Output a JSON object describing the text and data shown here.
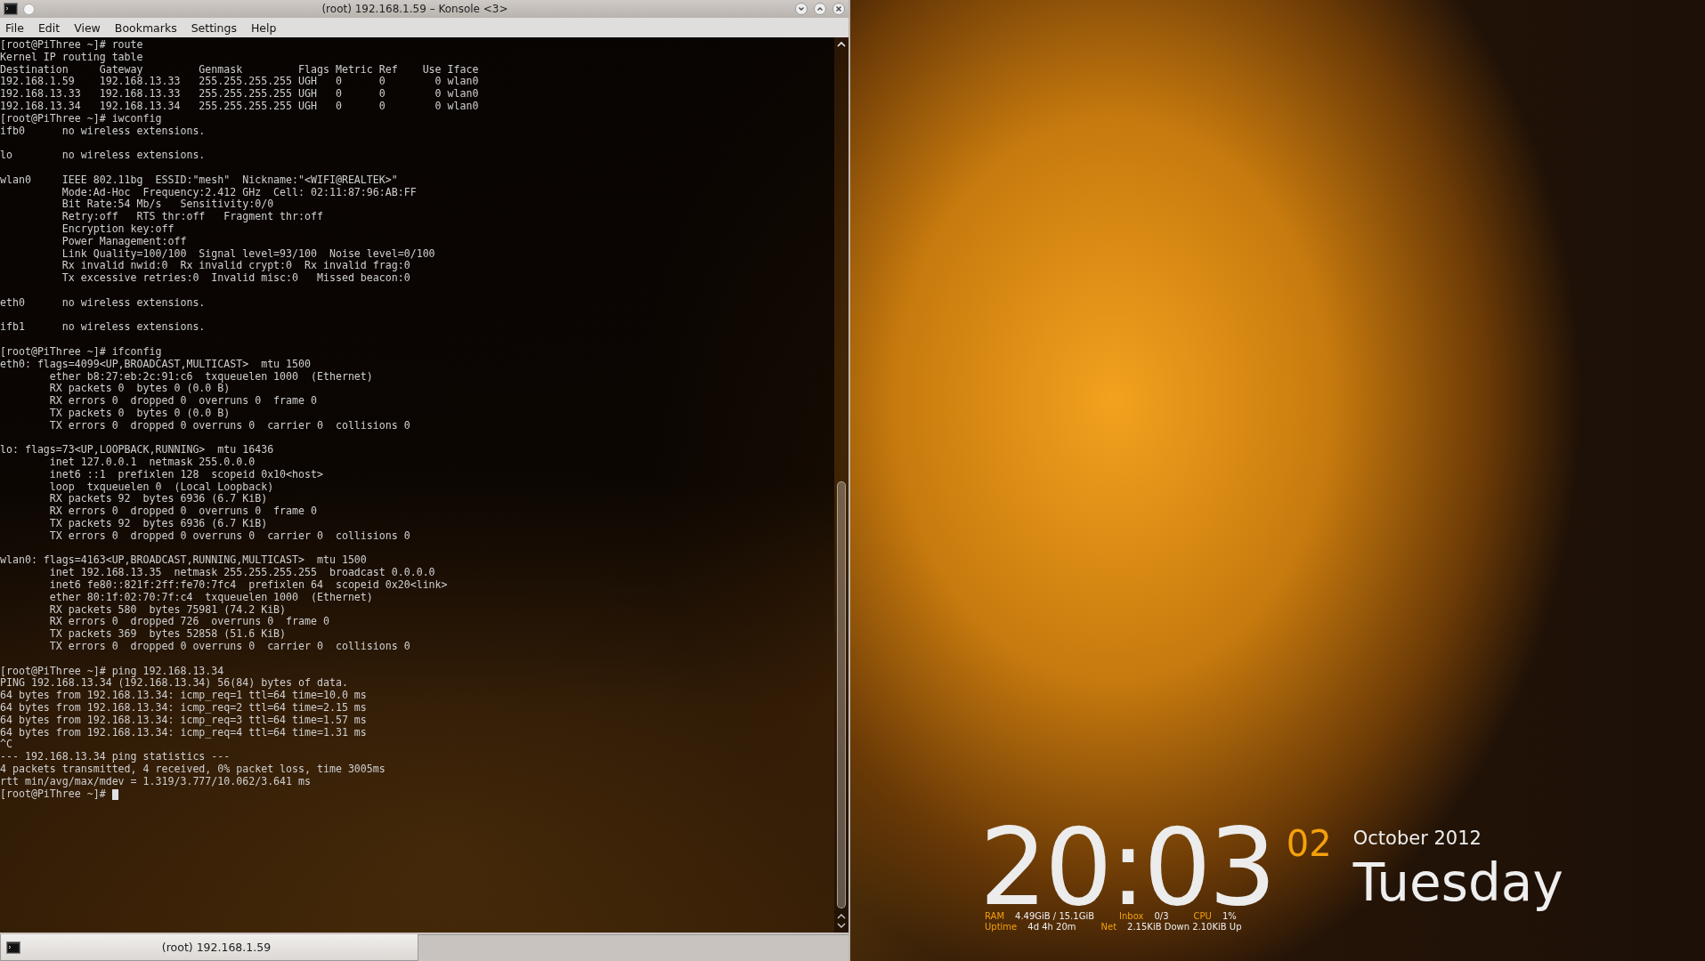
{
  "window": {
    "title": "(root) 192.168.1.59 – Konsole <3>"
  },
  "menu": [
    "File",
    "Edit",
    "View",
    "Bookmarks",
    "Settings",
    "Help"
  ],
  "terminal": {
    "paragraphs": [
      [
        "[root@PiThree ~]# route",
        "Kernel IP routing table",
        "Destination     Gateway         Genmask         Flags Metric Ref    Use Iface",
        "192.168.1.59    192.168.13.33   255.255.255.255 UGH   0      0        0 wlan0",
        "192.168.13.33   192.168.13.33   255.255.255.255 UGH   0      0        0 wlan0",
        "192.168.13.34   192.168.13.34   255.255.255.255 UGH   0      0        0 wlan0",
        "[root@PiThree ~]# iwconfig",
        "ifb0      no wireless extensions."
      ],
      [
        "lo        no wireless extensions."
      ],
      [
        "wlan0     IEEE 802.11bg  ESSID:\"mesh\"  Nickname:\"<WIFI@REALTEK>\"",
        "          Mode:Ad-Hoc  Frequency:2.412 GHz  Cell: 02:11:87:96:AB:FF",
        "          Bit Rate:54 Mb/s   Sensitivity:0/0",
        "          Retry:off   RTS thr:off   Fragment thr:off",
        "          Encryption key:off",
        "          Power Management:off",
        "          Link Quality=100/100  Signal level=93/100  Noise level=0/100",
        "          Rx invalid nwid:0  Rx invalid crypt:0  Rx invalid frag:0",
        "          Tx excessive retries:0  Invalid misc:0   Missed beacon:0"
      ],
      [
        "eth0      no wireless extensions."
      ],
      [
        "ifb1      no wireless extensions."
      ],
      [
        "[root@PiThree ~]# ifconfig",
        "eth0: flags=4099<UP,BROADCAST,MULTICAST>  mtu 1500",
        "        ether b8:27:eb:2c:91:c6  txqueuelen 1000  (Ethernet)",
        "        RX packets 0  bytes 0 (0.0 B)",
        "        RX errors 0  dropped 0  overruns 0  frame 0",
        "        TX packets 0  bytes 0 (0.0 B)",
        "        TX errors 0  dropped 0 overruns 0  carrier 0  collisions 0"
      ],
      [
        "lo: flags=73<UP,LOOPBACK,RUNNING>  mtu 16436",
        "        inet 127.0.0.1  netmask 255.0.0.0",
        "        inet6 ::1  prefixlen 128  scopeid 0x10<host>",
        "        loop  txqueuelen 0  (Local Loopback)",
        "        RX packets 92  bytes 6936 (6.7 KiB)",
        "        RX errors 0  dropped 0  overruns 0  frame 0",
        "        TX packets 92  bytes 6936 (6.7 KiB)",
        "        TX errors 0  dropped 0 overruns 0  carrier 0  collisions 0"
      ],
      [
        "wlan0: flags=4163<UP,BROADCAST,RUNNING,MULTICAST>  mtu 1500",
        "        inet 192.168.13.35  netmask 255.255.255.255  broadcast 0.0.0.0",
        "        inet6 fe80::821f:2ff:fe70:7fc4  prefixlen 64  scopeid 0x20<link>",
        "        ether 80:1f:02:70:7f:c4  txqueuelen 1000  (Ethernet)",
        "        RX packets 580  bytes 75981 (74.2 KiB)",
        "        RX errors 0  dropped 726  overruns 0  frame 0",
        "        TX packets 369  bytes 52858 (51.6 KiB)",
        "        TX errors 0  dropped 0 overruns 0  carrier 0  collisions 0"
      ],
      [
        "[root@PiThree ~]# ping 192.168.13.34",
        "PING 192.168.13.34 (192.168.13.34) 56(84) bytes of data.",
        "64 bytes from 192.168.13.34: icmp_req=1 ttl=64 time=10.0 ms",
        "64 bytes from 192.168.13.34: icmp_req=2 ttl=64 time=2.15 ms",
        "64 bytes from 192.168.13.34: icmp_req=3 ttl=64 time=1.57 ms",
        "64 bytes from 192.168.13.34: icmp_req=4 ttl=64 time=1.31 ms",
        "^C",
        "--- 192.168.13.34 ping statistics ---",
        "4 packets transmitted, 4 received, 0% packet loss, time 3005ms",
        "rtt min/avg/max/mdev = 1.319/3.777/10.062/3.641 ms"
      ]
    ],
    "prompt": "[root@PiThree ~]#"
  },
  "tabs": [
    {
      "label": "(root) 192.168.1.59",
      "selected": true
    }
  ],
  "clock": {
    "time": "20:03",
    "seconds": "02",
    "month_year": "October 2012",
    "weekday": "Tuesday",
    "stats": [
      [
        {
          "label": "RAM",
          "value": "4.49GiB / 15.1GiB"
        },
        {
          "label": "Inbox",
          "value": "0/3"
        },
        {
          "label": "CPU",
          "value": "1%"
        }
      ],
      [
        {
          "label": "Uptime",
          "value": "4d 4h 20m"
        },
        {
          "label": "Net",
          "value": "2.15KiB Down 2.10KiB Up"
        }
      ]
    ]
  }
}
